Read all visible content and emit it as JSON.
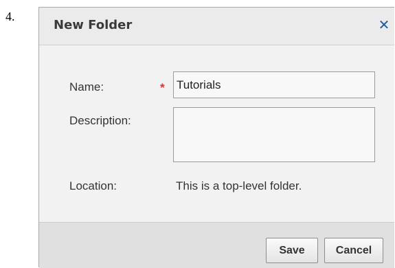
{
  "step_number": "4.",
  "dialog": {
    "title": "New Folder",
    "close_icon": "close-icon",
    "close_glyph": "✕"
  },
  "form": {
    "name_label": "Name:",
    "required_mark": "*",
    "name_value": "Tutorials",
    "description_label": "Description:",
    "description_value": "",
    "location_label": "Location:",
    "location_value": "This is a top-level folder."
  },
  "footer": {
    "save_label": "Save",
    "cancel_label": "Cancel"
  },
  "colors": {
    "required": "#e03030",
    "close_icon": "#1e5aa0"
  }
}
